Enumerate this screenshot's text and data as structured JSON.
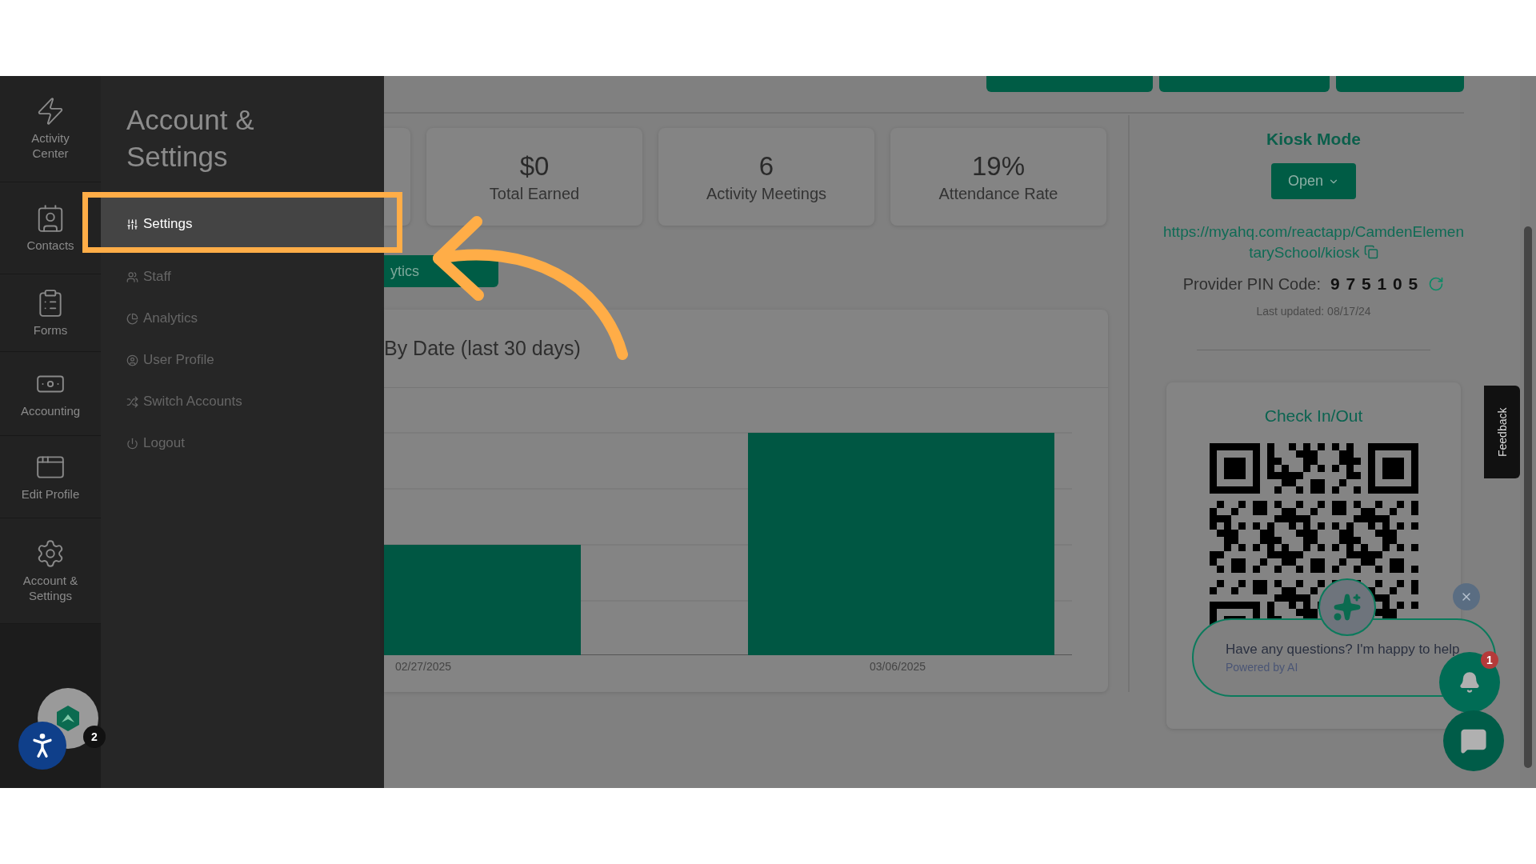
{
  "rail": [
    {
      "label": "Activity Center"
    },
    {
      "label": "Contacts"
    },
    {
      "label": "Forms"
    },
    {
      "label": "Accounting"
    },
    {
      "label": "Edit Profile"
    },
    {
      "label": "Account & Settings"
    }
  ],
  "flyout": {
    "title": "Account & Settings",
    "items": [
      {
        "label": "Settings",
        "selected": true
      },
      {
        "label": "Staff",
        "selected": false
      },
      {
        "label": "Analytics",
        "selected": false
      },
      {
        "label": "User Profile",
        "selected": false
      },
      {
        "label": "Switch Accounts",
        "selected": false
      },
      {
        "label": "Logout",
        "selected": false
      }
    ]
  },
  "avatar_badge": "2",
  "stats": [
    {
      "value": "$0",
      "label": "Total Earned"
    },
    {
      "value": "6",
      "label": "Activity Meetings"
    },
    {
      "value": "19%",
      "label": "Attendance Rate"
    }
  ],
  "analytics_button": "ytics",
  "chart": {
    "title": "By Date (last 30 days)",
    "x_labels": [
      "02/27/2025",
      "03/06/2025"
    ]
  },
  "kiosk": {
    "title": "Kiosk Mode",
    "button": "Open",
    "url": "https://myahq.com/reactapp/CamdenElementarySchool/kiosk",
    "pin_label": "Provider PIN Code:",
    "pin": "9 7 5 1 0 5",
    "updated": "Last updated: 08/17/24"
  },
  "checkin": {
    "title": "Check In/Out"
  },
  "chat": {
    "message": "Have any questions? I'm happy to help",
    "note": "Powered by AI",
    "badge": "1"
  },
  "feedback": "Feedback"
}
